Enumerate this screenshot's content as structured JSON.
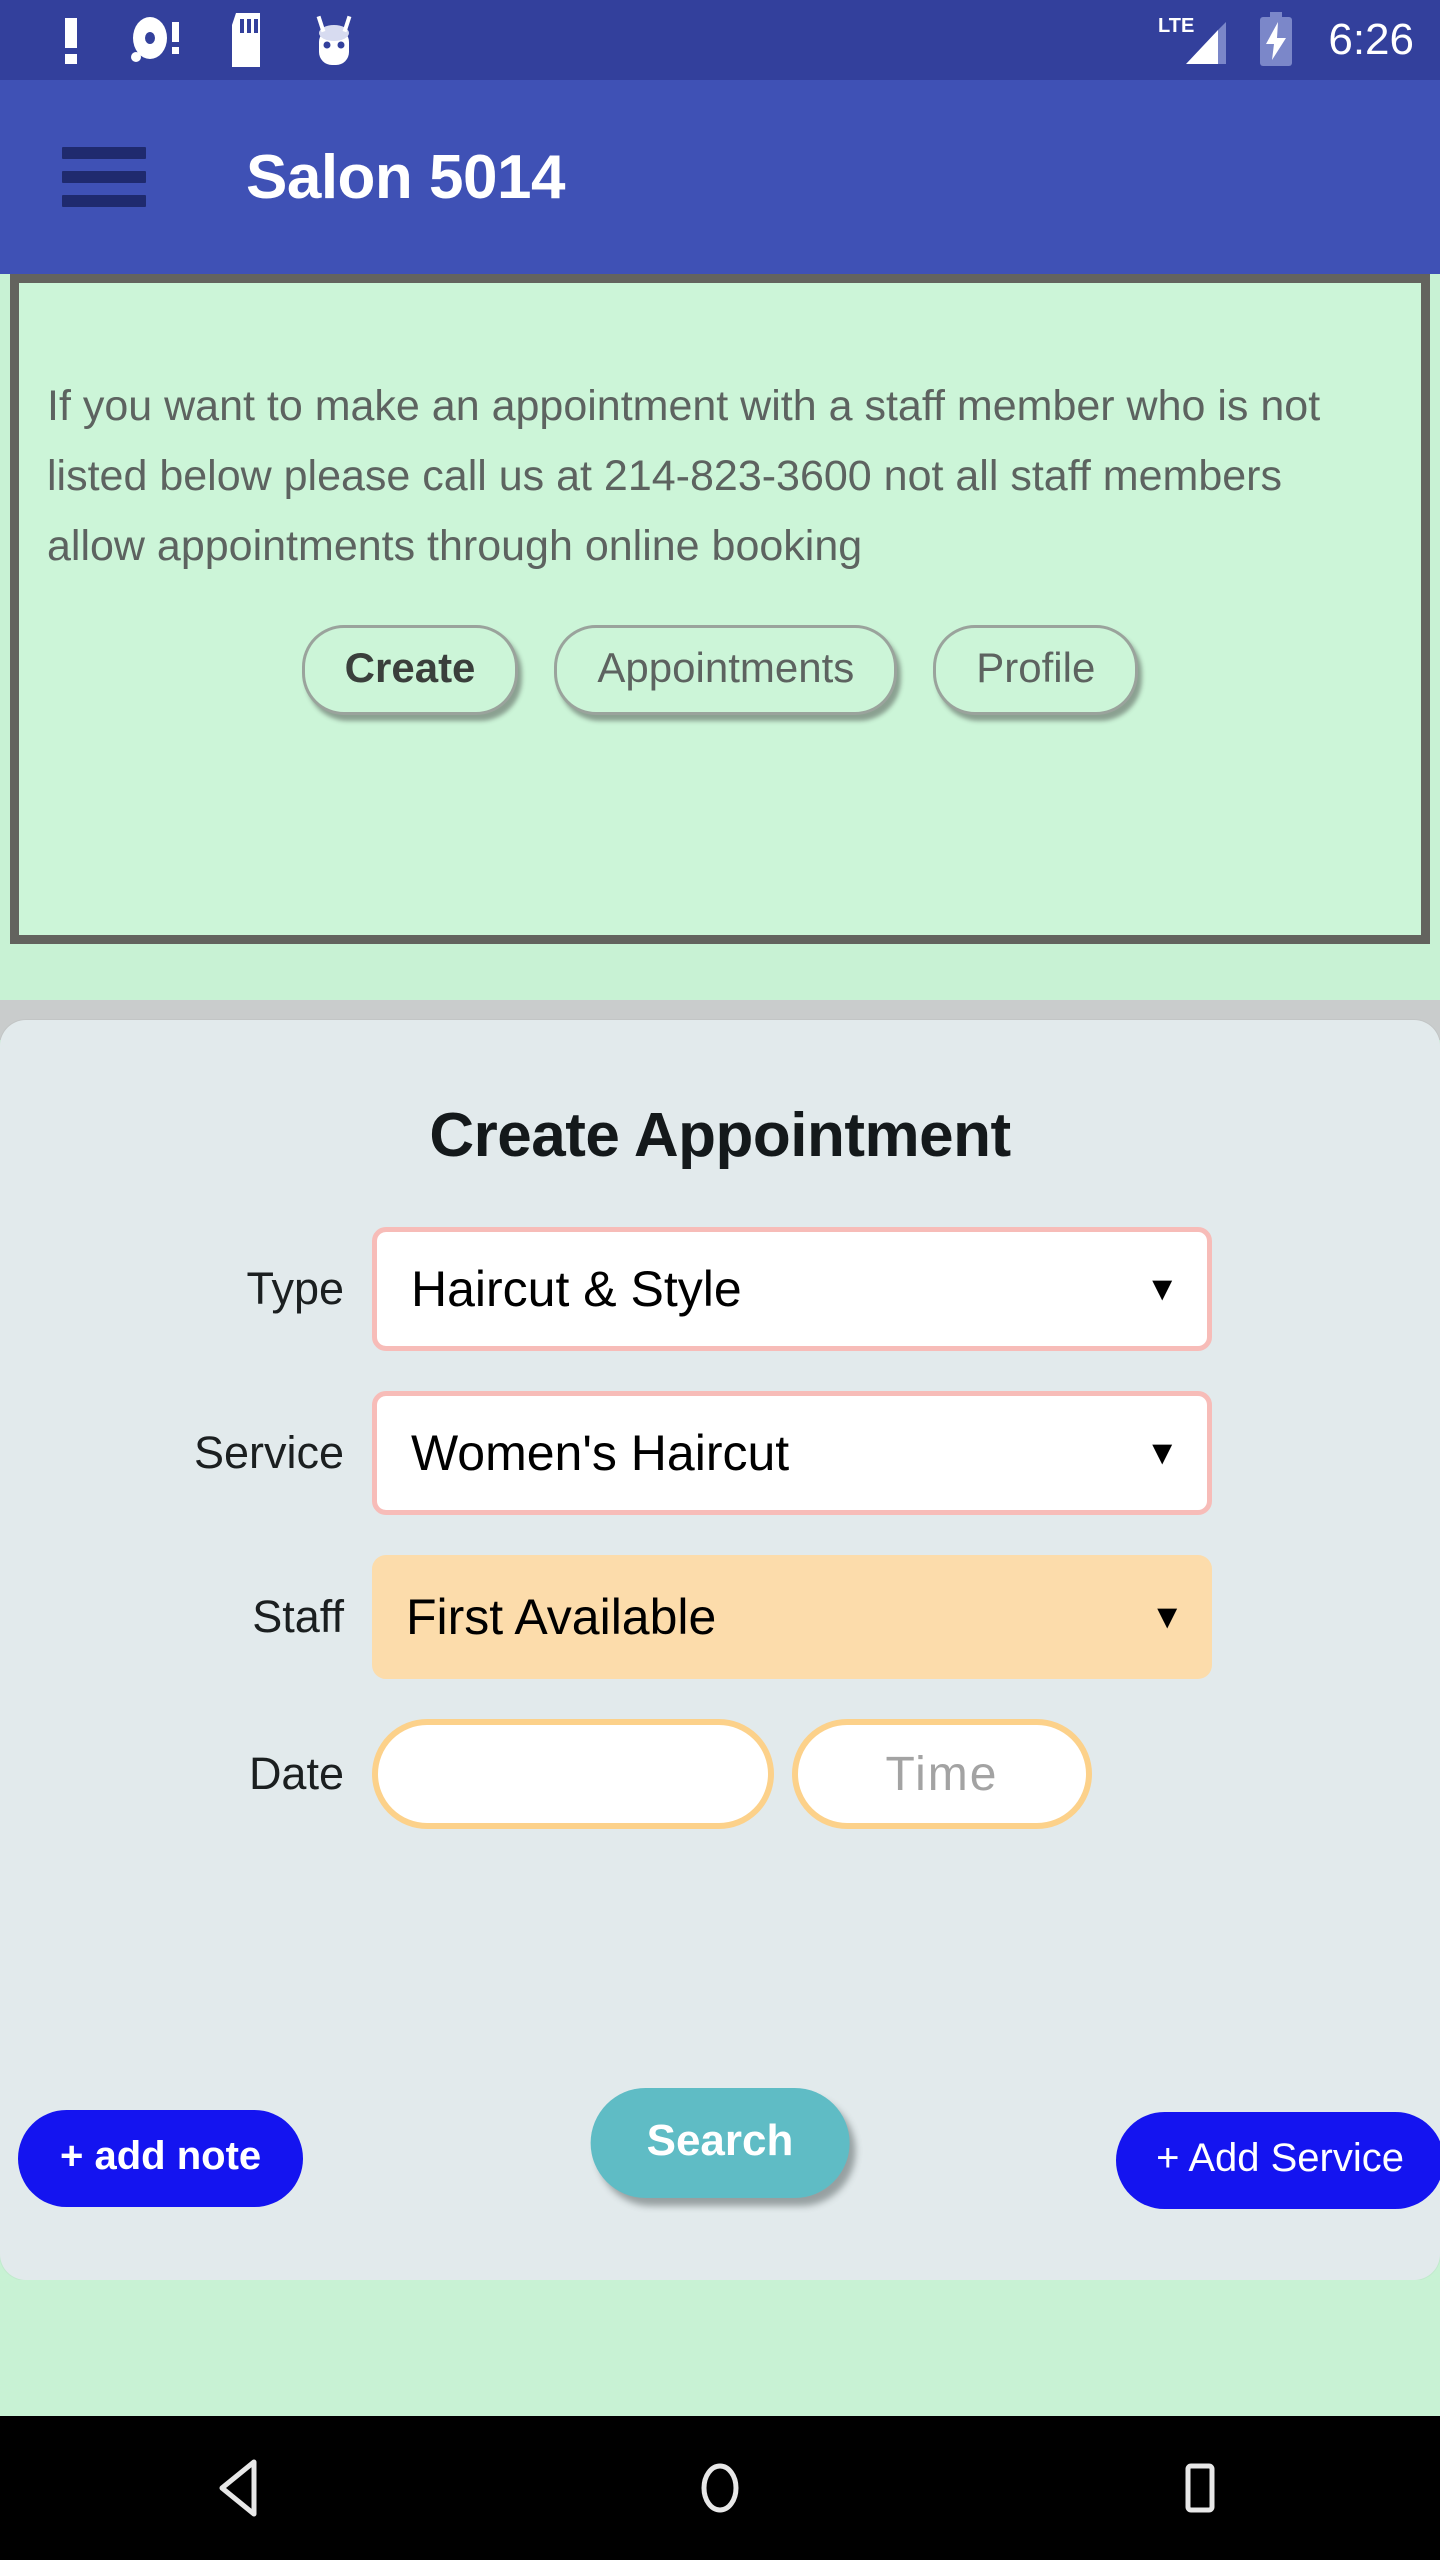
{
  "status_bar": {
    "icons": [
      "warning-exclamation-icon",
      "disc-alert-icon",
      "sd-card-icon",
      "android-head-icon"
    ],
    "network": "LTE",
    "signal": "signal-bars-icon",
    "battery": "battery-charging-icon",
    "time": "6:26"
  },
  "app_bar": {
    "menu_icon": "hamburger-menu-icon",
    "title": "Salon 5014"
  },
  "notice": {
    "message": "If you want to make an appointment with a staff member who is not listed below please call us at 214-823-3600 not all staff members allow appointments through online booking",
    "phone": "214-823-3600",
    "tabs": [
      {
        "label": "Create",
        "active": true
      },
      {
        "label": "Appointments",
        "active": false
      },
      {
        "label": "Profile",
        "active": false
      }
    ]
  },
  "card": {
    "title": "Create Appointment",
    "fields": {
      "type": {
        "label": "Type",
        "value": "Haircut & Style",
        "caret": "▼"
      },
      "service": {
        "label": "Service",
        "value": "Women's Haircut",
        "caret": "▼"
      },
      "staff": {
        "label": "Staff",
        "value": "First Available",
        "caret": "▼"
      },
      "date": {
        "label": "Date",
        "date_value": "",
        "date_placeholder": "",
        "time_value": "",
        "time_placeholder": "Time"
      }
    },
    "buttons": {
      "add_note": "+ add note",
      "search": "Search",
      "add_service": "+ Add Service"
    }
  },
  "nav_bar": {
    "back": "back-triangle-icon",
    "home": "home-circle-icon",
    "recents": "recents-square-icon"
  },
  "colors": {
    "status_bar": "#33409c",
    "app_bar": "#3f51b5",
    "banner_bg": "#ccf5d8",
    "banner_border": "#63635e",
    "page_bg": "#c8f2d4",
    "card_bg": "#e2eaec",
    "select_border_pink": "#f7bcb8",
    "select_fill_peach": "#fcdcab",
    "date_border": "#fcd18a",
    "search_button": "#5fbcc5",
    "blue_button": "#1414f0"
  }
}
